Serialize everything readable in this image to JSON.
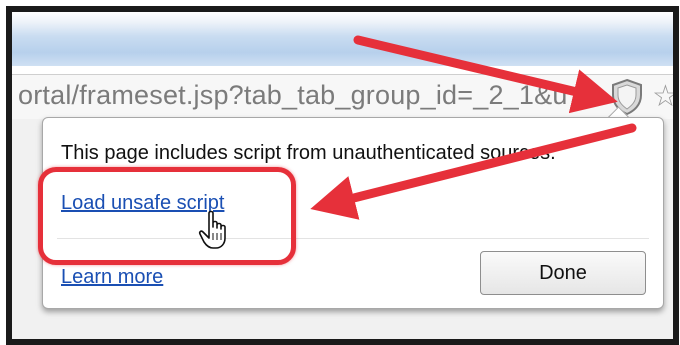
{
  "address_bar": {
    "url_text": "ortal/frameset.jsp?tab_tab_group_id=_2_1&u",
    "shield_icon": "shield-icon",
    "star_icon": "star-icon"
  },
  "bubble": {
    "message": "This page includes script from unauthenticated sources.",
    "load_unsafe_label": "Load unsafe script",
    "learn_more_label": "Learn more",
    "done_label": "Done"
  },
  "annotations": {
    "highlight_color": "#e6303a",
    "arrow_color": "#e6303a",
    "cursor_icon": "hand-pointer-icon"
  }
}
